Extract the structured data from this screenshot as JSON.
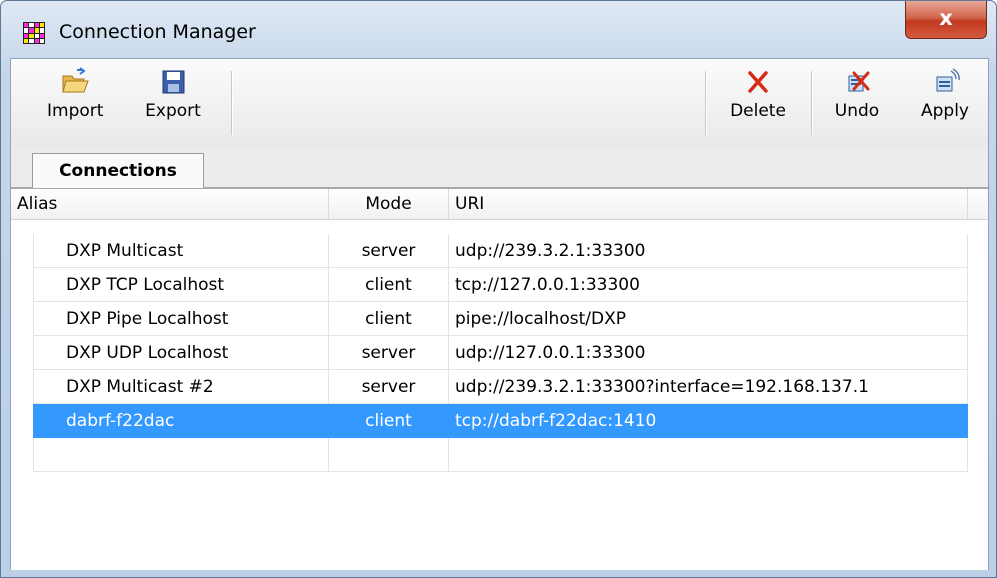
{
  "window": {
    "title": "Connection Manager",
    "close_glyph": "x"
  },
  "toolbar": {
    "import_label": "Import",
    "export_label": "Export",
    "delete_label": "Delete",
    "undo_label": "Undo",
    "apply_label": "Apply"
  },
  "tabs": [
    {
      "label": "Connections"
    }
  ],
  "table": {
    "columns": [
      "Alias",
      "Mode",
      "URI"
    ],
    "rows": [
      {
        "alias": "DXP Multicast",
        "mode": "server",
        "uri": "udp://239.3.2.1:33300"
      },
      {
        "alias": "DXP TCP Localhost",
        "mode": "client",
        "uri": "tcp://127.0.0.1:33300"
      },
      {
        "alias": "DXP Pipe Localhost",
        "mode": "client",
        "uri": "pipe://localhost/DXP"
      },
      {
        "alias": "DXP UDP Localhost",
        "mode": "server",
        "uri": "udp://127.0.0.1:33300"
      },
      {
        "alias": "DXP Multicast #2",
        "mode": "server",
        "uri": "udp://239.3.2.1:33300?interface=192.168.137.1"
      },
      {
        "alias": "dabrf-f22dac",
        "mode": "client",
        "uri": "tcp://dabrf-f22dac:1410"
      },
      {
        "alias": "",
        "mode": "",
        "uri": ""
      }
    ],
    "selected_row": 5
  },
  "colors": {
    "selection": "#3399ff",
    "close_button": "#c2391f",
    "delete_icon": "#d62a14"
  }
}
